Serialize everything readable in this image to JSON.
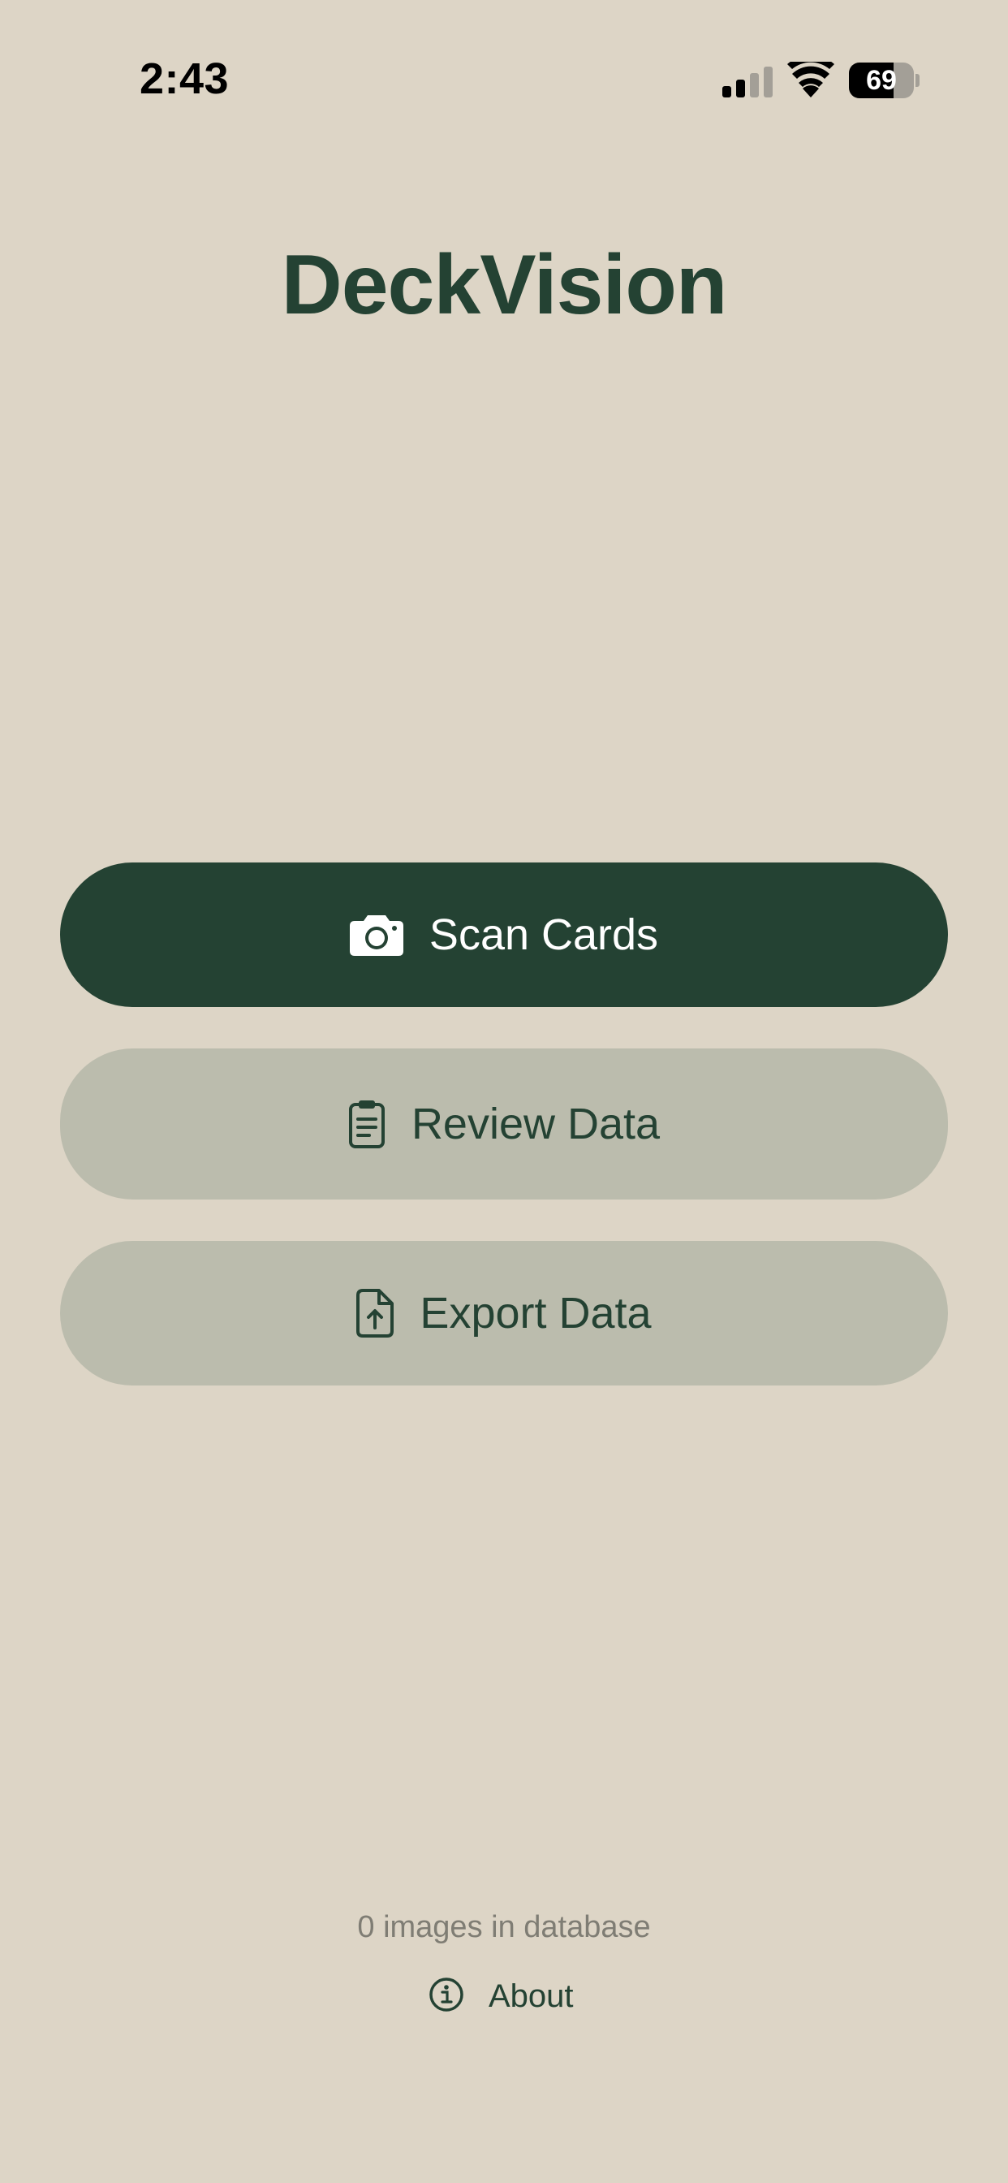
{
  "status_bar": {
    "time": "2:43",
    "battery_level": "69",
    "icons": [
      "cellular-signal-icon",
      "wifi-icon",
      "battery-icon"
    ]
  },
  "app": {
    "title": "DeckVision"
  },
  "menu": {
    "scan": {
      "label": "Scan Cards",
      "icon": "camera-icon"
    },
    "review": {
      "label": "Review Data",
      "icon": "clipboard-icon"
    },
    "export": {
      "label": "Export Data",
      "icon": "file-export-icon"
    }
  },
  "footer": {
    "db_status": "0 images in database",
    "about_label": "About",
    "about_icon": "info-icon"
  },
  "colors": {
    "background": "#ddd5c6",
    "primary": "#244233",
    "secondary_button": "#bbbcad",
    "muted_text": "#7f7d74"
  }
}
